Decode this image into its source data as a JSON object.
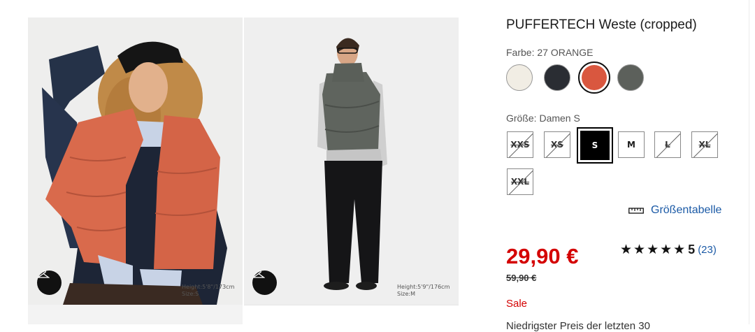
{
  "gallery": {
    "images": [
      {
        "alt": "Model im orangefarbenen PUFFERTECH Weste",
        "height_text": "Height:5'8\"/173cm",
        "size_text": "Size:S",
        "vest_color": "#d96a4c"
      },
      {
        "alt": "Model im grünen PUFFERTECH Weste",
        "height_text": "Height:5'9\"/176cm",
        "size_text": "Size:M",
        "vest_color": "#5f645e"
      }
    ],
    "hanger_icon": "hanger-icon"
  },
  "product": {
    "title": "PUFFERTECH Weste (cropped)",
    "color_label": "Farbe: 27 ORANGE",
    "colors": [
      {
        "name": "Off White",
        "hex": "#f1ede4",
        "selected": false
      },
      {
        "name": "Navy",
        "hex": "#2a2d33",
        "selected": false
      },
      {
        "name": "Orange",
        "hex": "#d9573f",
        "selected": true
      },
      {
        "name": "Dark Green",
        "hex": "#5c605b",
        "selected": false
      }
    ],
    "size_label": "Größe: Damen S",
    "sizes": [
      {
        "label": "XXS",
        "available": false,
        "selected": false
      },
      {
        "label": "XS",
        "available": false,
        "selected": false
      },
      {
        "label": "S",
        "available": true,
        "selected": true
      },
      {
        "label": "M",
        "available": true,
        "selected": false
      },
      {
        "label": "L",
        "available": false,
        "selected": false
      },
      {
        "label": "XL",
        "available": false,
        "selected": false
      },
      {
        "label": "XXL",
        "available": false,
        "selected": false
      }
    ],
    "size_chart_label": "Größentabelle",
    "size_chart_icon": "ruler-icon",
    "price": "29,90 €",
    "old_price": "59,90 €",
    "rating": {
      "stars": "★★★★★",
      "value": "5",
      "count": "(23)"
    },
    "sale_label": "Sale",
    "cut_off_text": "Niedrigster Preis der letzten 30"
  },
  "colors": {
    "sale_red": "#d40000",
    "link_blue": "#1b5aa6"
  }
}
